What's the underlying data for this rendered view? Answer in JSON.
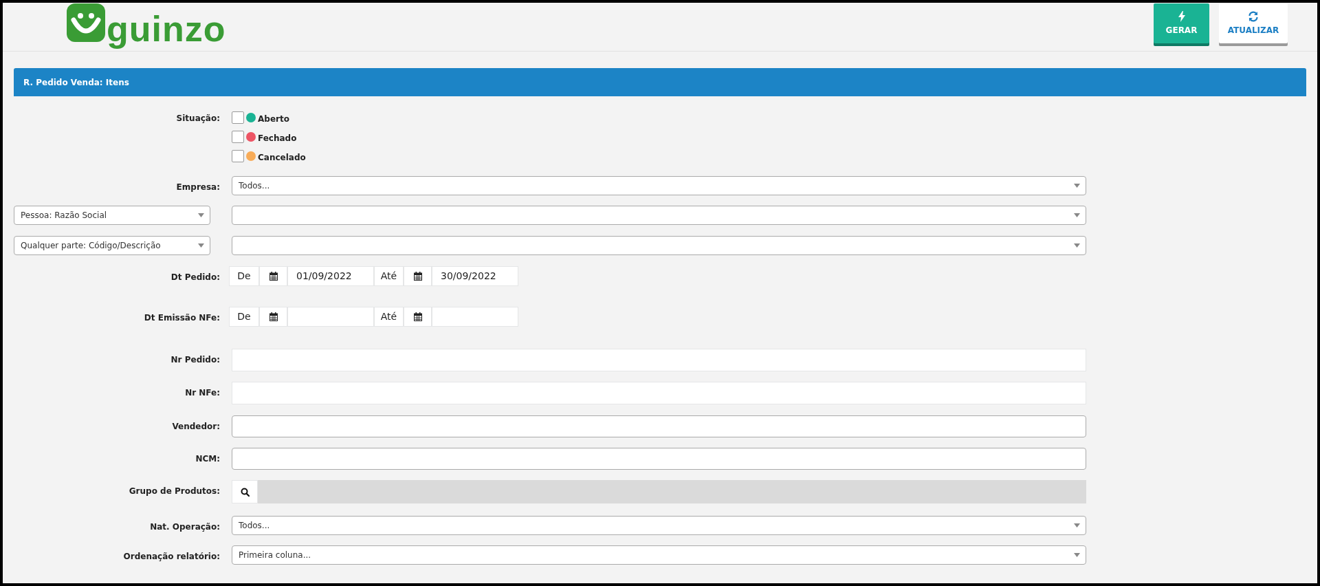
{
  "header": {
    "logo_text": "guinzo",
    "buttons": [
      {
        "label": "GERAR",
        "kind": "primary"
      },
      {
        "label": "ATUALIZAR",
        "kind": "secondary"
      }
    ]
  },
  "panel": {
    "title": "R. Pedido Venda: Itens",
    "fields": [
      {
        "kind": "checkboxes",
        "label": "Situação:",
        "options": [
          {
            "label": "Aberto",
            "checked": false,
            "color": "#1ab394"
          },
          {
            "label": "Fechado",
            "checked": false,
            "color": "#ed5565"
          },
          {
            "label": "Cancelado",
            "checked": false,
            "color": "#f8ac59"
          }
        ]
      },
      {
        "kind": "select",
        "label": "Empresa:",
        "value": "Todos..."
      },
      {
        "kind": "select_pair",
        "selector": "Pessoa: Razão Social"
      },
      {
        "kind": "select_pair",
        "selector": "Qualquer parte: Código/Descrição"
      },
      {
        "kind": "date_range",
        "label": "Dt Pedido:",
        "from_label": "De",
        "from": "01/09/2022",
        "to_label": "Até",
        "to": "30/09/2022"
      },
      {
        "kind": "date_range",
        "label": "Dt Emissão NFe:",
        "from_label": "De",
        "to_label": "Até"
      },
      {
        "kind": "text_flat",
        "label": "Nr Pedido:"
      },
      {
        "kind": "text_flat",
        "label": "Nr NFe:"
      },
      {
        "kind": "text",
        "label": "Vendedor:"
      },
      {
        "kind": "text",
        "label": "NCM:"
      },
      {
        "kind": "lookup",
        "label": "Grupo de Produtos:"
      },
      {
        "kind": "select",
        "label": "Nat. Operação:",
        "value": "Todos..."
      },
      {
        "kind": "select",
        "label": "Ordenação relatório:",
        "value": "Primeira coluna..."
      }
    ]
  }
}
